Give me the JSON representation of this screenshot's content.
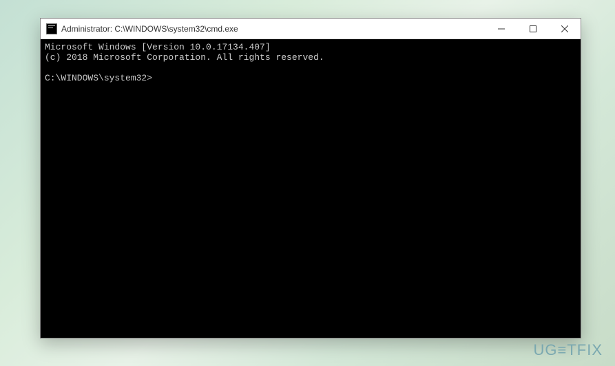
{
  "window": {
    "title": "Administrator: C:\\WINDOWS\\system32\\cmd.exe"
  },
  "terminal": {
    "line1": "Microsoft Windows [Version 10.0.17134.407]",
    "line2": "(c) 2018 Microsoft Corporation. All rights reserved.",
    "blank": "",
    "prompt": "C:\\WINDOWS\\system32>"
  },
  "watermark": {
    "text": "UG≡TFIX"
  }
}
